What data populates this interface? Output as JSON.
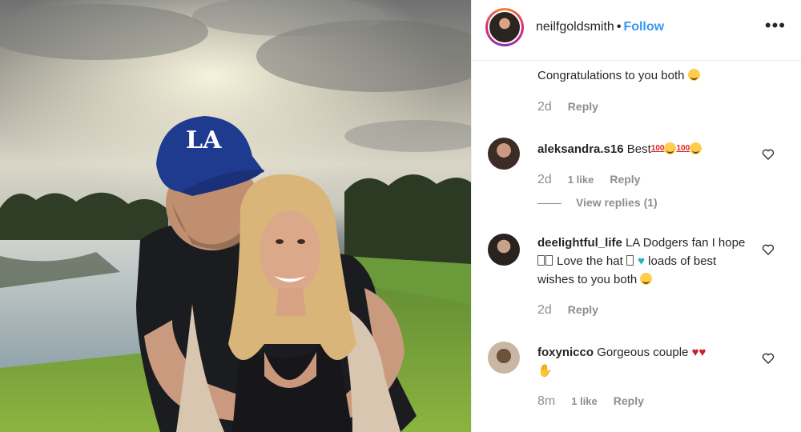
{
  "post": {
    "photo_alt": "",
    "cap_logo_text": "LA"
  },
  "header": {
    "username": "neilfgoldsmith",
    "separator": "•",
    "follow_label": "Follow",
    "more_icon": "more-horizontal-icon"
  },
  "comments": [
    {
      "username": "",
      "text": "Congratulations to you both",
      "time": "2d",
      "likes": "",
      "reply_label": "Reply"
    },
    {
      "username": "aleksandra.s16",
      "text": "Best",
      "suffix": "100",
      "time": "2d",
      "likes": "1 like",
      "reply_label": "Reply",
      "view_replies": "View replies (1)"
    },
    {
      "username": "deelightful_life",
      "text": "LA Dodgers fan I hope",
      "text_2": "Love the hat",
      "text_3": "loads of best wishes to you both",
      "time": "2d",
      "likes": "",
      "reply_label": "Reply"
    },
    {
      "username": "foxynicco",
      "text": "Gorgeous couple",
      "time": "8m",
      "likes": "1 like",
      "reply_label": "Reply"
    }
  ],
  "colors": {
    "link": "#3897f0",
    "muted": "#8e8e8e",
    "text": "#262626",
    "cap": "#1f3b8f"
  }
}
